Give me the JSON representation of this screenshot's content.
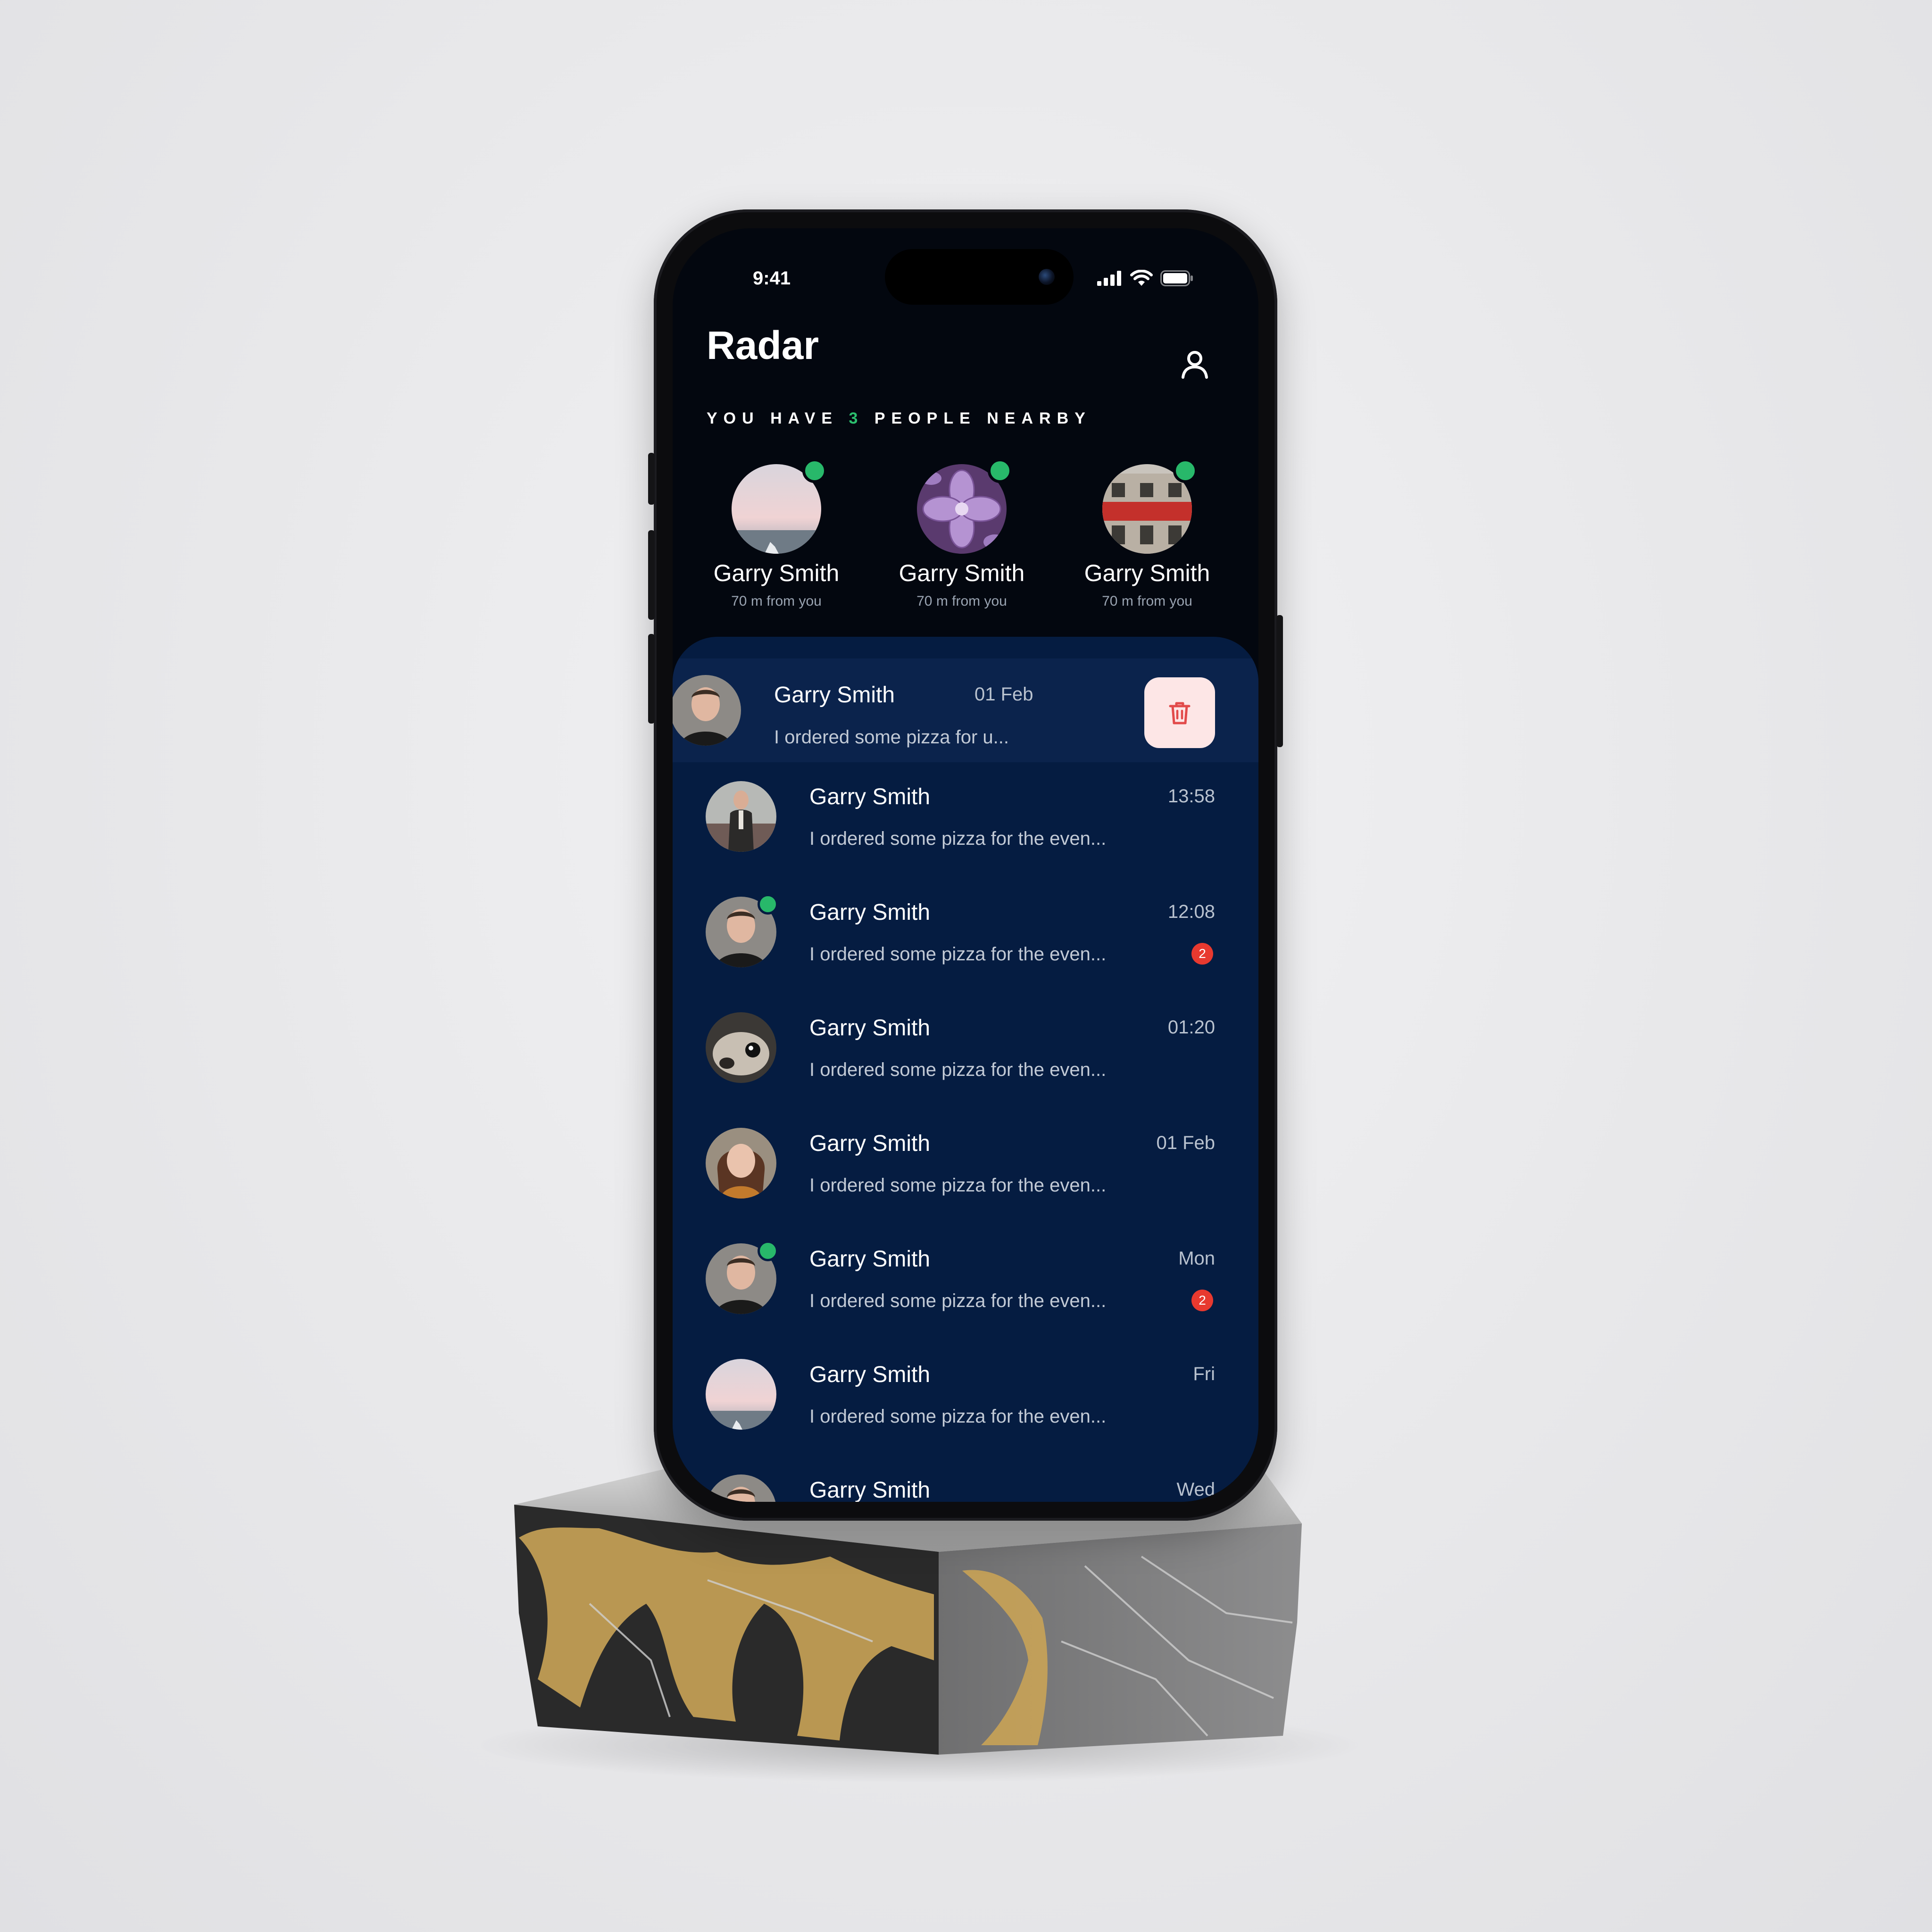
{
  "status_bar": {
    "time": "9:41"
  },
  "header": {
    "title": "Radar",
    "subtitle_prefix": "YOU HAVE ",
    "people_count": "3",
    "subtitle_suffix": " PEOPLE NEARBY"
  },
  "nearby": [
    {
      "name": "Garry Smith",
      "distance": "70 m from you",
      "online": true,
      "avatar": "sky-photo"
    },
    {
      "name": "Garry Smith",
      "distance": "70 m from you",
      "online": true,
      "avatar": "lilac-flower-photo"
    },
    {
      "name": "Garry Smith",
      "distance": "70 m from you",
      "online": true,
      "avatar": "red-building-photo"
    }
  ],
  "chats": [
    {
      "name": "Garry Smith",
      "time": "01 Feb",
      "message": "I ordered some pizza for u...",
      "swiped": true,
      "avatar": "man-portrait"
    },
    {
      "name": "Garry Smith",
      "time": "13:58",
      "message": "I ordered some pizza for the even...",
      "avatar": "man-suit-photo"
    },
    {
      "name": "Garry Smith",
      "time": "12:08",
      "message": "I ordered some pizza for the even...",
      "online": true,
      "unread": "2",
      "avatar": "man-portrait"
    },
    {
      "name": "Garry Smith",
      "time": "01:20",
      "message": "I ordered some pizza for the even...",
      "avatar": "dog-photo"
    },
    {
      "name": "Garry Smith",
      "time": "01 Feb",
      "message": "I ordered some pizza for the even...",
      "avatar": "woman-portrait"
    },
    {
      "name": "Garry Smith",
      "time": "Mon",
      "message": "I ordered some pizza for the even...",
      "online": true,
      "unread": "2",
      "avatar": "man-portrait"
    },
    {
      "name": "Garry Smith",
      "time": "Fri",
      "message": "I ordered some pizza for the even...",
      "avatar": "sky-photo"
    },
    {
      "name": "Garry Smith",
      "time": "Wed",
      "message": "",
      "avatar": "man-portrait"
    }
  ],
  "icons": {
    "profile": "user-icon",
    "delete": "trash-icon",
    "signal": "cellular-signal-icon",
    "wifi": "wifi-icon",
    "battery": "battery-icon"
  },
  "colors": {
    "background": "#03070f",
    "chat_panel": "#051c41",
    "accent_green": "#2bbf6e",
    "unread_red": "#e8392f",
    "delete_bg": "#fde6e6",
    "delete_icon": "#e24a4a"
  }
}
